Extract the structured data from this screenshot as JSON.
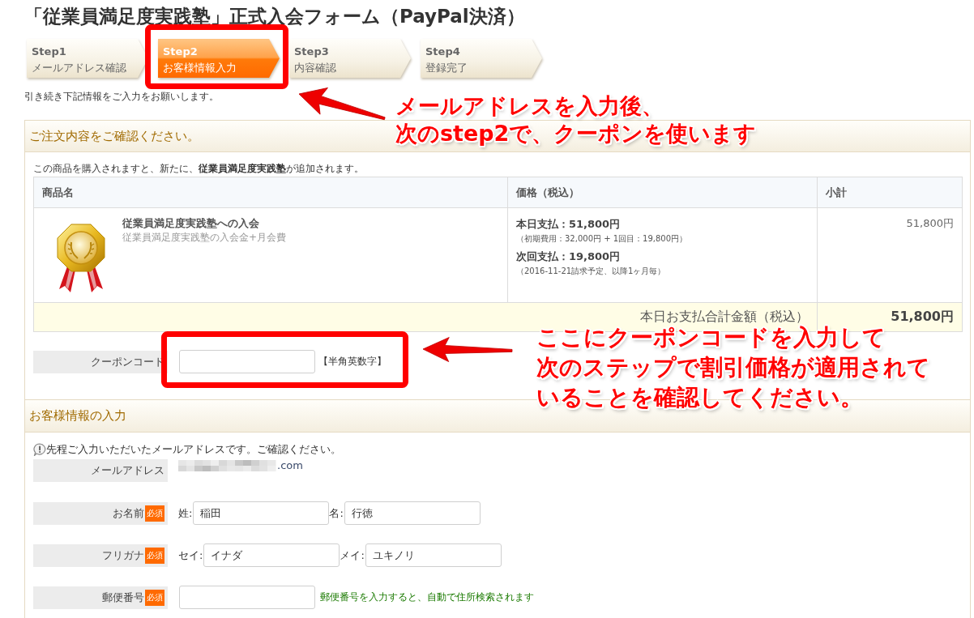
{
  "title": "「従業員満足度実践塾」正式入会フォーム（PayPal決済）",
  "steps": [
    {
      "number": "Step1",
      "label": "メールアドレス確認",
      "selected": false
    },
    {
      "number": "Step2",
      "label": "お客様情報入力",
      "selected": true
    },
    {
      "number": "Step3",
      "label": "内容確認",
      "selected": false
    },
    {
      "number": "Step4",
      "label": "登録完了",
      "selected": false
    }
  ],
  "intro": "引き続き下記情報をご入力をお願いします。",
  "order_section": {
    "heading": "ご注文内容をご確認ください。",
    "note": "この商品を購入されますと、新たに、**従業員満足度実践塾**が追加されます。",
    "table": {
      "columns": [
        "商品名",
        "価格（税込）",
        "小計"
      ],
      "rows": [
        {
          "name": "従業員満足度実践塾への入会",
          "description": "従業員満足度実践塾の入会金+月会費",
          "price_lines": [
            {
              "kind": "amount",
              "text": "本日支払：51,800円"
            },
            {
              "kind": "detail",
              "text": "（初期費用：32,000円 + 1回目：19,800円）"
            },
            {
              "kind": "amount",
              "text": "次回支払：19,800円"
            },
            {
              "kind": "detail",
              "text": "（2016-11-21請求予定、以降1ヶ月毎）"
            }
          ],
          "subtotal": "51,800円"
        }
      ],
      "total": {
        "label": "本日お支払合計金額（税込）",
        "value": "51,800円"
      }
    },
    "coupon": {
      "label": "クーポンコード",
      "hint": "【半角英数字】"
    }
  },
  "customer_section": {
    "heading": "お客様情報の入力",
    "notice": "先程ご入力いただいたメールアドレスです。ご確認ください。",
    "fields": [
      {
        "kind": "display",
        "label": "メールアドレス",
        "redacted": true,
        "value": ".com"
      },
      {
        "kind": "pair",
        "label": "お名前",
        "badge": "必須",
        "parts": [
          {
            "prefix": "姓:",
            "value": "稲田"
          },
          {
            "prefix": "名:",
            "value": "行徳"
          }
        ]
      },
      {
        "kind": "pair",
        "label": "フリガナ",
        "badge": "必須",
        "parts": [
          {
            "prefix": "セイ:",
            "value": "イナダ"
          },
          {
            "prefix": "メイ:",
            "value": "ユキノリ"
          }
        ]
      },
      {
        "kind": "input",
        "label": "郵便番号",
        "badge": "必須",
        "help": "郵便番号を入力すると、自動で住所検索されます"
      }
    ]
  },
  "annotations": [
    {
      "kind": "step-callout",
      "lines": [
        "メールアドレスを入力後、",
        "次の**step2**で、クーポンを使います"
      ]
    },
    {
      "kind": "coupon-callout",
      "lines": [
        "ここにクーポンコードを入力して",
        "次のステップで割引価格が適用されて",
        "いることを確認してください。"
      ]
    }
  ]
}
